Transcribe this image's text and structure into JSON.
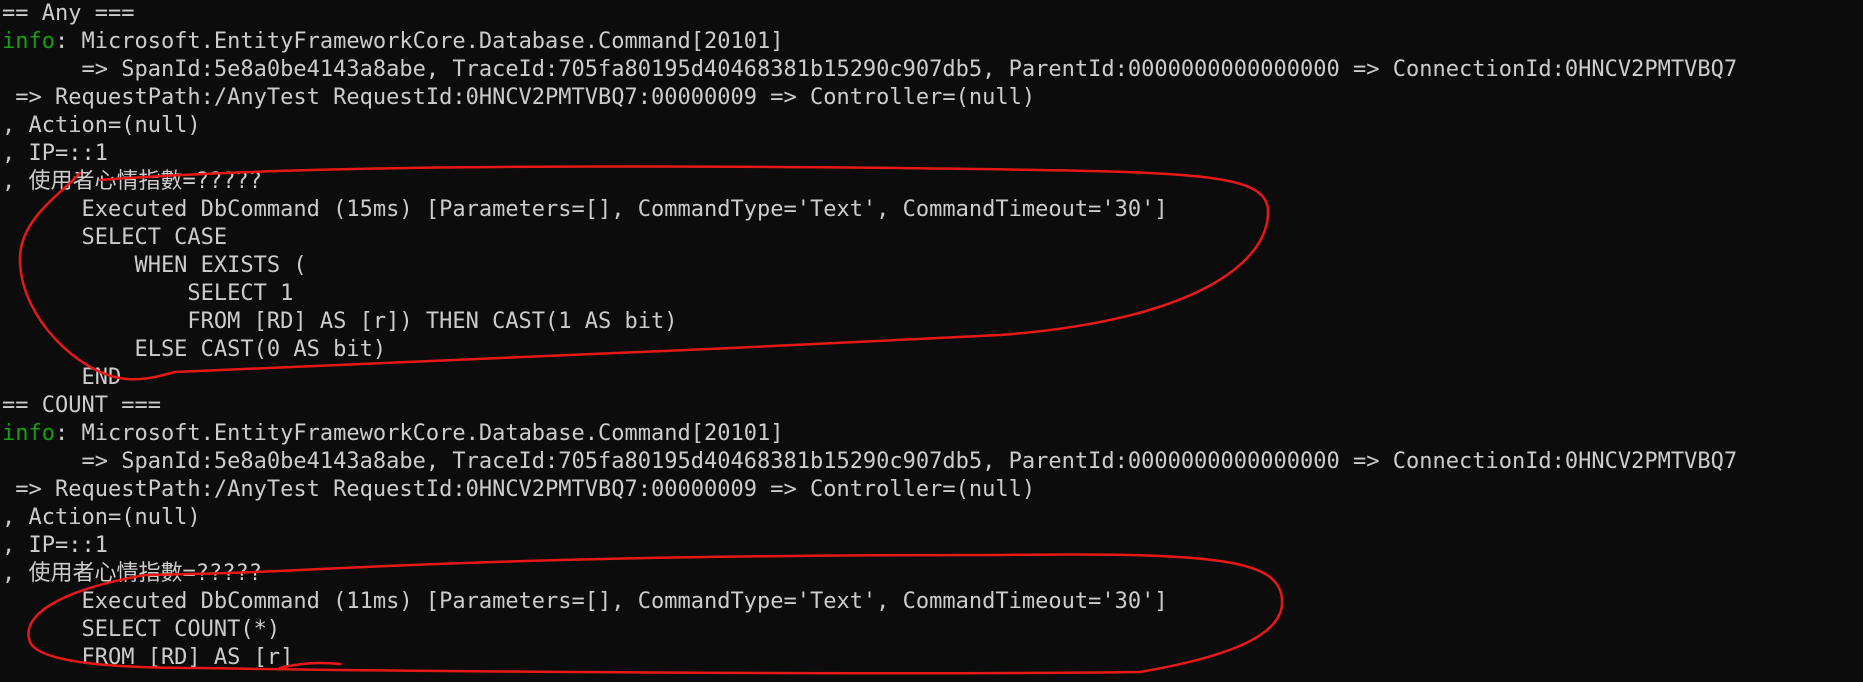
{
  "colors": {
    "background": "#0c0c0c",
    "text": "#cccccc",
    "info": "#13a10e",
    "annotation": "#e81818"
  },
  "lines": [
    {
      "label": "",
      "text": "== Any ==="
    },
    {
      "label": "info",
      "text": ": Microsoft.EntityFrameworkCore.Database.Command[20101]"
    },
    {
      "label": "",
      "text": "      => SpanId:5e8a0be4143a8abe, TraceId:705fa80195d40468381b15290c907db5, ParentId:0000000000000000 => ConnectionId:0HNCV2PMTVBQ7"
    },
    {
      "label": "",
      "text": " => RequestPath:/AnyTest RequestId:0HNCV2PMTVBQ7:00000009 => Controller=(null)"
    },
    {
      "label": "",
      "text": ", Action=(null)"
    },
    {
      "label": "",
      "text": ", IP=::1"
    },
    {
      "label": "",
      "text": ", 使用者心情指數=?????"
    },
    {
      "label": "",
      "text": "      Executed DbCommand (15ms) [Parameters=[], CommandType='Text', CommandTimeout='30']"
    },
    {
      "label": "",
      "text": "      SELECT CASE"
    },
    {
      "label": "",
      "text": "          WHEN EXISTS ("
    },
    {
      "label": "",
      "text": "              SELECT 1"
    },
    {
      "label": "",
      "text": "              FROM [RD] AS [r]) THEN CAST(1 AS bit)"
    },
    {
      "label": "",
      "text": "          ELSE CAST(0 AS bit)"
    },
    {
      "label": "",
      "text": "      END"
    },
    {
      "label": "",
      "text": "== COUNT ==="
    },
    {
      "label": "info",
      "text": ": Microsoft.EntityFrameworkCore.Database.Command[20101]"
    },
    {
      "label": "",
      "text": "      => SpanId:5e8a0be4143a8abe, TraceId:705fa80195d40468381b15290c907db5, ParentId:0000000000000000 => ConnectionId:0HNCV2PMTVBQ7"
    },
    {
      "label": "",
      "text": " => RequestPath:/AnyTest RequestId:0HNCV2PMTVBQ7:00000009 => Controller=(null)"
    },
    {
      "label": "",
      "text": ", Action=(null)"
    },
    {
      "label": "",
      "text": ", IP=::1"
    },
    {
      "label": "",
      "text": ", 使用者心情指數=?????"
    },
    {
      "label": "",
      "text": "      Executed DbCommand (11ms) [Parameters=[], CommandType='Text', CommandTimeout='30']"
    },
    {
      "label": "",
      "text": "      SELECT COUNT(*)"
    },
    {
      "label": "",
      "text": "      FROM [RD] AS [r]"
    }
  ]
}
